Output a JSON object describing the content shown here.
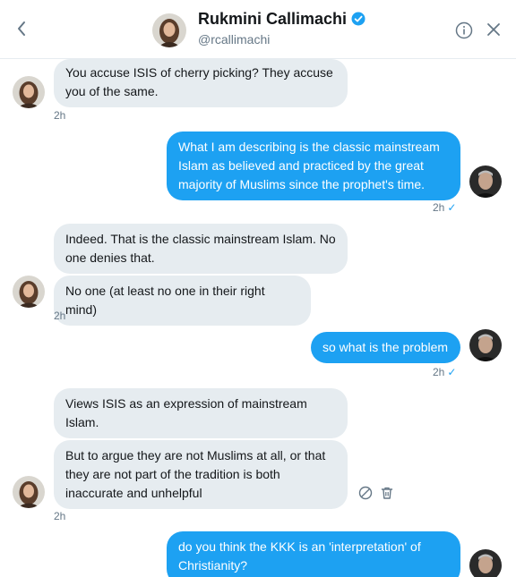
{
  "header": {
    "back_icon": "chevron-left-icon",
    "name": "Rukmini Callimachi",
    "handle": "@rcallimachi",
    "verified_icon": "verified-badge-icon",
    "info_icon": "info-icon",
    "close_icon": "close-icon"
  },
  "colors": {
    "accent": "#1da1f2",
    "incoming_bubble": "#e6ecf0",
    "meta_text": "#657786"
  },
  "messages": [
    {
      "direction": "incoming",
      "text": "You accuse ISIS of cherry picking? They accuse you of the same."
    },
    {
      "direction": "incoming",
      "time": "2h"
    },
    {
      "direction": "outgoing",
      "text": "What I am describing is the classic mainstream Islam as believed and practiced by the great majority of Muslims since the prophet's time.",
      "time": "2h",
      "status_icon": "sent-check-icon"
    },
    {
      "direction": "incoming",
      "text": "Indeed. That is the classic mainstream Islam. No one denies that."
    },
    {
      "direction": "incoming",
      "text": "No one (at least no one in their right mind)",
      "time": "2h"
    },
    {
      "direction": "outgoing",
      "text": "so what is the problem",
      "time": "2h",
      "status_icon": "sent-check-icon"
    },
    {
      "direction": "incoming",
      "text": "Views ISIS as an expression of mainstream Islam."
    },
    {
      "direction": "incoming",
      "text": "But to argue they are not Muslims at all, or that they are not part of the tradition is both inaccurate and unhelpful",
      "time": "2h",
      "actions": [
        "report-icon",
        "delete-icon"
      ]
    },
    {
      "direction": "outgoing",
      "text": "do you think the KKK is an 'interpretation' of Christianity?"
    }
  ]
}
